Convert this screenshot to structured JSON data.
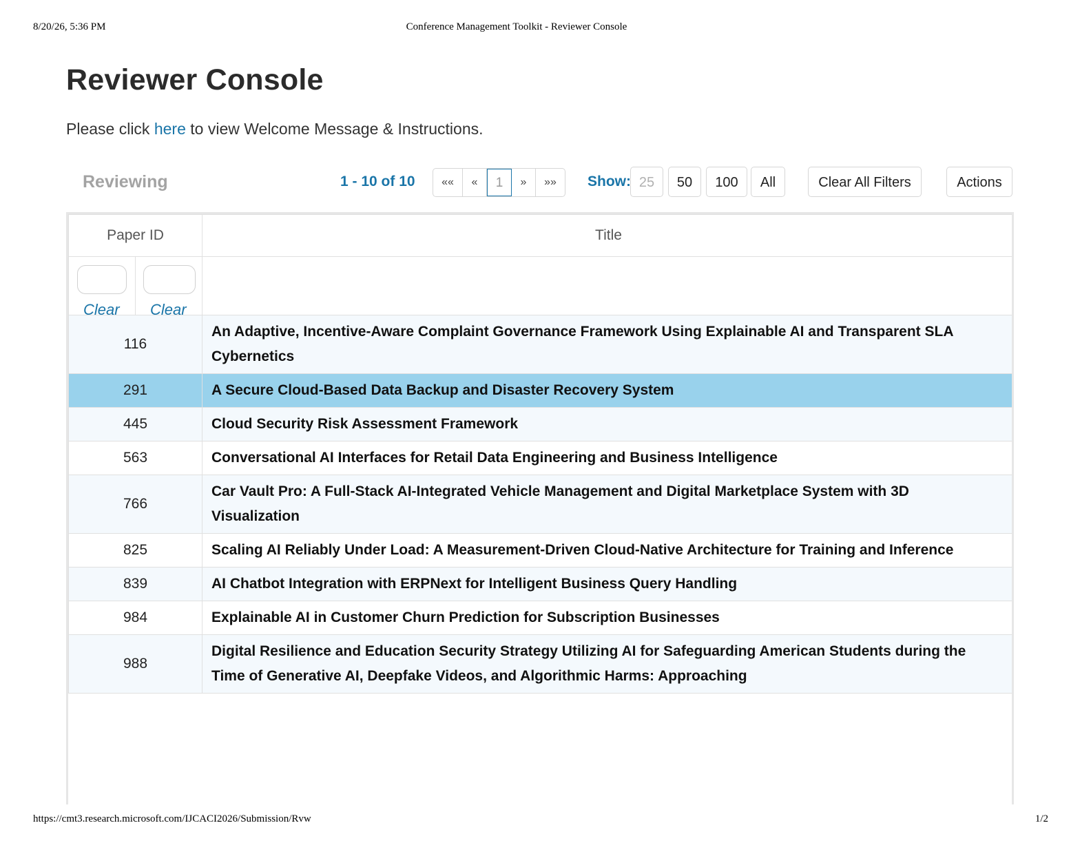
{
  "print_header": {
    "datetime": "8/20/26, 5:36 PM",
    "page_title": "Conference Management Toolkit - Reviewer Console"
  },
  "print_footer": {
    "url": "https://cmt3.research.microsoft.com/IJCACI2026/Submission/Rvw",
    "page": "1/2"
  },
  "page": {
    "title": "Reviewer Console",
    "intro_before": "Please click ",
    "intro_link": "here",
    "intro_after": " to view Welcome Message & Instructions."
  },
  "toolbar": {
    "heading": "Reviewing",
    "range": "1 - 10 of 10",
    "pager": {
      "first": "««",
      "prev": "«",
      "current": "1",
      "next": "»",
      "last": "»»"
    },
    "show_label": "Show:",
    "show_options": [
      "25",
      "50",
      "100",
      "All"
    ],
    "clear_filters": "Clear All Filters",
    "actions": "Actions"
  },
  "table": {
    "columns": [
      "Paper ID",
      "Title"
    ],
    "filter_clear_labels": [
      "Clear",
      "Clear"
    ],
    "rows": [
      {
        "id": "116",
        "title": "An Adaptive, Incentive-Aware Complaint Governance Framework Using Explainable AI and Transparent SLA Cybernetics"
      },
      {
        "id": "291",
        "title": "A Secure Cloud-Based Data Backup and Disaster Recovery System",
        "selected": true
      },
      {
        "id": "445",
        "title": "Cloud Security Risk Assessment Framework"
      },
      {
        "id": "563",
        "title": "Conversational AI Interfaces for Retail Data Engineering and Business Intelligence"
      },
      {
        "id": "766",
        "title": "Car Vault Pro: A Full-Stack AI-Integrated Vehicle Management and Digital Marketplace System with 3D Visualization"
      },
      {
        "id": "825",
        "title": "Scaling AI Reliably Under Load: A Measurement-Driven Cloud-Native Architecture for Training and Inference"
      },
      {
        "id": "839",
        "title": "AI Chatbot Integration with ERPNext for Intelligent Business Query Handling"
      },
      {
        "id": "984",
        "title": "Explainable AI in Customer Churn Prediction for Subscription Businesses"
      },
      {
        "id": "988",
        "title": "Digital Resilience and Education Security Strategy Utilizing AI for Safeguarding American Students during the Time of Generative AI, Deepfake Videos, and Algorithmic Harms: Approaching"
      }
    ]
  },
  "colors": {
    "accent": "#1a75a8",
    "selected_row": "#99d2ec",
    "alt_row": "#f4f9fd"
  }
}
